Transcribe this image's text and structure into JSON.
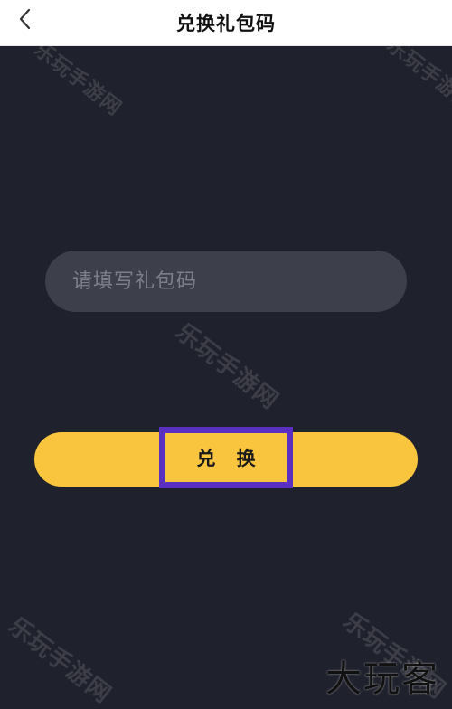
{
  "header": {
    "title": "兑换礼包码",
    "back_icon": "chevron-left-icon"
  },
  "redeem_form": {
    "placeholder": "请填写礼包码",
    "value": "",
    "submit_label": "兑 换"
  },
  "watermarks": [
    "乐玩手游网",
    "乐玩手游网",
    "乐玩手游网",
    "乐玩手游网",
    "乐玩手游网"
  ],
  "logo": "大玩客",
  "colors": {
    "background": "#1f212c",
    "input_background": "#3d3f4b",
    "button": "#f9c43e",
    "highlight": "#5b2fbf"
  }
}
